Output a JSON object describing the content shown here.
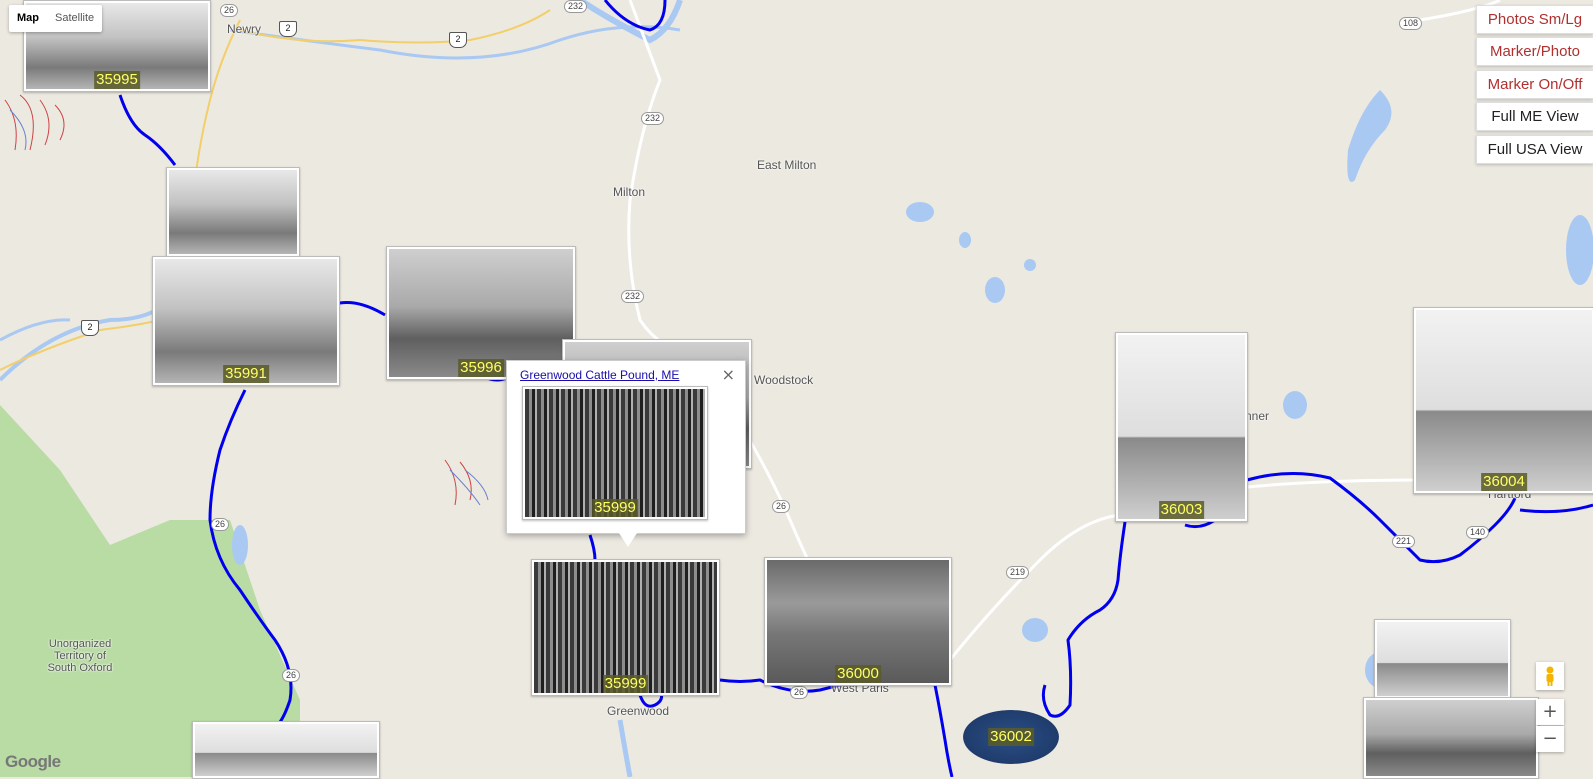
{
  "map_type_control": {
    "map": "Map",
    "satellite": "Satellite"
  },
  "controls": [
    {
      "label": "Photos Sm/Lg",
      "style": "red"
    },
    {
      "label": "Marker/Photo",
      "style": "red"
    },
    {
      "label": "Marker On/Off",
      "style": "red"
    },
    {
      "label": "Full ME View",
      "style": "dark"
    },
    {
      "label": "Full USA View",
      "style": "dark"
    }
  ],
  "places": {
    "newry": "Newry",
    "east_milton": "East Milton",
    "milton": "Milton",
    "woodstock": "Woodstock",
    "bryant": "nner",
    "hartford": "Hartford",
    "west_paris": "West Paris",
    "greenwood": "Greenwood",
    "unorganized": "Unorganized Territory of South Oxford"
  },
  "routes": {
    "r26a": "26",
    "r232a": "232",
    "r232b": "232",
    "r232c": "232",
    "r26b": "26",
    "r219": "219",
    "r108": "108",
    "r26c": "26",
    "r2a": "2",
    "r2b": "2",
    "r2c": "2",
    "r140": "140",
    "r221": "221",
    "r232d": "232"
  },
  "markers": {
    "m35995": "35995",
    "m35991": "35991",
    "m35996": "35996",
    "m35999": "35999",
    "m36000": "36000",
    "m36002": "36002",
    "m36003": "36003",
    "m36004": "36004"
  },
  "infowindow": {
    "title": "Greenwood Cattle Pound, ME",
    "photo_label": "35999",
    "close": "×"
  },
  "zoom": {
    "in": "+",
    "out": "−"
  },
  "attribution": "Google",
  "colors": {
    "track": "#0000ee",
    "water": "#a9c9f3",
    "park": "#b9dba4",
    "land": "#ece9e1"
  }
}
